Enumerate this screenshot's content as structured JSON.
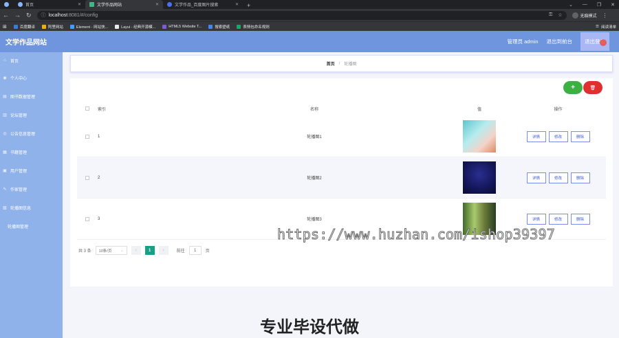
{
  "browser": {
    "tabs": [
      {
        "title": "首页",
        "active": false
      },
      {
        "title": "文学作品网站",
        "active": true
      },
      {
        "title": "文学作品_百度图片搜索",
        "active": false
      }
    ],
    "url_host": "localhost",
    "url_path": ":8081/#/config",
    "profile_label": "无痕模式",
    "bookmarks": [
      "百度翻译",
      "阿里网站",
      "Element - 网站快...",
      "Layui - 经典开源模...",
      "HTML5 Website T...",
      "搜索壁纸",
      "表情包命名规则"
    ],
    "reading_list": "阅读清单",
    "colors": {
      "tabbar": "#202124",
      "toolbar": "#35363a"
    }
  },
  "app": {
    "title": "文学作品网站",
    "header": {
      "admin_label": "管理员 admin",
      "exit_to_front": "退出到前台",
      "logout": "退出登录"
    },
    "colors": {
      "header": "#6e95de",
      "sidebar": "#8fb2ea",
      "accent": "#3f57c9",
      "add": "#3cb043",
      "delete": "#e02f2f",
      "page_active": "#16a085"
    }
  },
  "sidebar": {
    "items": [
      {
        "label": "首页",
        "icon": "home-icon"
      },
      {
        "label": "个人中心",
        "icon": "user-icon"
      },
      {
        "label": "图书数据管理",
        "icon": "book-icon"
      },
      {
        "label": "论坛管理",
        "icon": "forum-icon"
      },
      {
        "label": "公告信息管理",
        "icon": "notice-icon"
      },
      {
        "label": "书籍管理",
        "icon": "grid-icon"
      },
      {
        "label": "用户管理",
        "icon": "users-icon"
      },
      {
        "label": "作家管理",
        "icon": "writer-icon"
      },
      {
        "label": "轮播图信息",
        "icon": "image-icon"
      },
      {
        "label": "轮播图管理",
        "icon": ""
      }
    ]
  },
  "breadcrumb": {
    "home": "首页",
    "separator": "/",
    "current": "轮播图"
  },
  "table": {
    "headers": {
      "index": "索引",
      "name": "名称",
      "value": "值",
      "ops": "操作"
    },
    "rows": [
      {
        "index": "1",
        "name": "轮播图1",
        "thumb": "thumb1"
      },
      {
        "index": "2",
        "name": "轮播图2",
        "thumb": "thumb2"
      },
      {
        "index": "3",
        "name": "轮播图3",
        "thumb": "thumb3"
      }
    ],
    "op_labels": {
      "detail": "详情",
      "edit": "修改",
      "delete": "删除"
    }
  },
  "toolbar": {
    "add_label": "+",
    "delete_label": "🗑"
  },
  "pagination": {
    "total_text": "共 3 条",
    "page_size": "10条/页",
    "current_page": "1",
    "goto_label": "前往",
    "goto_value": "1",
    "page_suffix": "页"
  },
  "watermark": "https://www.huzhan.com/ishop39397",
  "caption": "专业毕设代做"
}
